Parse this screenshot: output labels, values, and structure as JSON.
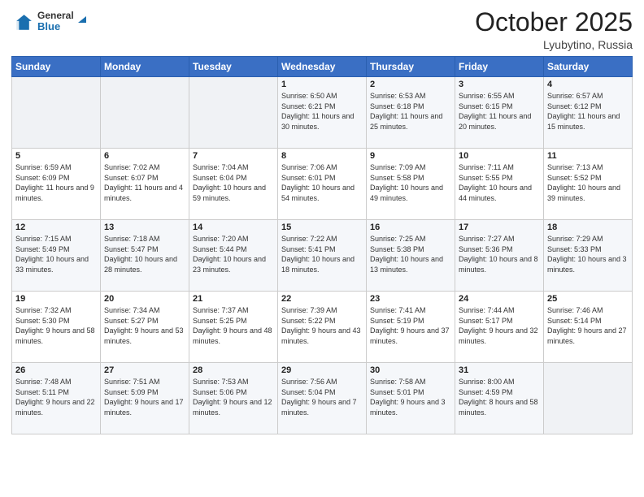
{
  "header": {
    "logo_line1": "General",
    "logo_line2": "Blue",
    "month": "October 2025",
    "location": "Lyubytino, Russia"
  },
  "weekdays": [
    "Sunday",
    "Monday",
    "Tuesday",
    "Wednesday",
    "Thursday",
    "Friday",
    "Saturday"
  ],
  "weeks": [
    [
      {
        "day": "",
        "sunrise": "",
        "sunset": "",
        "daylight": "",
        "empty": true
      },
      {
        "day": "",
        "sunrise": "",
        "sunset": "",
        "daylight": "",
        "empty": true
      },
      {
        "day": "",
        "sunrise": "",
        "sunset": "",
        "daylight": "",
        "empty": true
      },
      {
        "day": "1",
        "sunrise": "Sunrise: 6:50 AM",
        "sunset": "Sunset: 6:21 PM",
        "daylight": "Daylight: 11 hours and 30 minutes.",
        "empty": false
      },
      {
        "day": "2",
        "sunrise": "Sunrise: 6:53 AM",
        "sunset": "Sunset: 6:18 PM",
        "daylight": "Daylight: 11 hours and 25 minutes.",
        "empty": false
      },
      {
        "day": "3",
        "sunrise": "Sunrise: 6:55 AM",
        "sunset": "Sunset: 6:15 PM",
        "daylight": "Daylight: 11 hours and 20 minutes.",
        "empty": false
      },
      {
        "day": "4",
        "sunrise": "Sunrise: 6:57 AM",
        "sunset": "Sunset: 6:12 PM",
        "daylight": "Daylight: 11 hours and 15 minutes.",
        "empty": false
      }
    ],
    [
      {
        "day": "5",
        "sunrise": "Sunrise: 6:59 AM",
        "sunset": "Sunset: 6:09 PM",
        "daylight": "Daylight: 11 hours and 9 minutes.",
        "empty": false
      },
      {
        "day": "6",
        "sunrise": "Sunrise: 7:02 AM",
        "sunset": "Sunset: 6:07 PM",
        "daylight": "Daylight: 11 hours and 4 minutes.",
        "empty": false
      },
      {
        "day": "7",
        "sunrise": "Sunrise: 7:04 AM",
        "sunset": "Sunset: 6:04 PM",
        "daylight": "Daylight: 10 hours and 59 minutes.",
        "empty": false
      },
      {
        "day": "8",
        "sunrise": "Sunrise: 7:06 AM",
        "sunset": "Sunset: 6:01 PM",
        "daylight": "Daylight: 10 hours and 54 minutes.",
        "empty": false
      },
      {
        "day": "9",
        "sunrise": "Sunrise: 7:09 AM",
        "sunset": "Sunset: 5:58 PM",
        "daylight": "Daylight: 10 hours and 49 minutes.",
        "empty": false
      },
      {
        "day": "10",
        "sunrise": "Sunrise: 7:11 AM",
        "sunset": "Sunset: 5:55 PM",
        "daylight": "Daylight: 10 hours and 44 minutes.",
        "empty": false
      },
      {
        "day": "11",
        "sunrise": "Sunrise: 7:13 AM",
        "sunset": "Sunset: 5:52 PM",
        "daylight": "Daylight: 10 hours and 39 minutes.",
        "empty": false
      }
    ],
    [
      {
        "day": "12",
        "sunrise": "Sunrise: 7:15 AM",
        "sunset": "Sunset: 5:49 PM",
        "daylight": "Daylight: 10 hours and 33 minutes.",
        "empty": false
      },
      {
        "day": "13",
        "sunrise": "Sunrise: 7:18 AM",
        "sunset": "Sunset: 5:47 PM",
        "daylight": "Daylight: 10 hours and 28 minutes.",
        "empty": false
      },
      {
        "day": "14",
        "sunrise": "Sunrise: 7:20 AM",
        "sunset": "Sunset: 5:44 PM",
        "daylight": "Daylight: 10 hours and 23 minutes.",
        "empty": false
      },
      {
        "day": "15",
        "sunrise": "Sunrise: 7:22 AM",
        "sunset": "Sunset: 5:41 PM",
        "daylight": "Daylight: 10 hours and 18 minutes.",
        "empty": false
      },
      {
        "day": "16",
        "sunrise": "Sunrise: 7:25 AM",
        "sunset": "Sunset: 5:38 PM",
        "daylight": "Daylight: 10 hours and 13 minutes.",
        "empty": false
      },
      {
        "day": "17",
        "sunrise": "Sunrise: 7:27 AM",
        "sunset": "Sunset: 5:36 PM",
        "daylight": "Daylight: 10 hours and 8 minutes.",
        "empty": false
      },
      {
        "day": "18",
        "sunrise": "Sunrise: 7:29 AM",
        "sunset": "Sunset: 5:33 PM",
        "daylight": "Daylight: 10 hours and 3 minutes.",
        "empty": false
      }
    ],
    [
      {
        "day": "19",
        "sunrise": "Sunrise: 7:32 AM",
        "sunset": "Sunset: 5:30 PM",
        "daylight": "Daylight: 9 hours and 58 minutes.",
        "empty": false
      },
      {
        "day": "20",
        "sunrise": "Sunrise: 7:34 AM",
        "sunset": "Sunset: 5:27 PM",
        "daylight": "Daylight: 9 hours and 53 minutes.",
        "empty": false
      },
      {
        "day": "21",
        "sunrise": "Sunrise: 7:37 AM",
        "sunset": "Sunset: 5:25 PM",
        "daylight": "Daylight: 9 hours and 48 minutes.",
        "empty": false
      },
      {
        "day": "22",
        "sunrise": "Sunrise: 7:39 AM",
        "sunset": "Sunset: 5:22 PM",
        "daylight": "Daylight: 9 hours and 43 minutes.",
        "empty": false
      },
      {
        "day": "23",
        "sunrise": "Sunrise: 7:41 AM",
        "sunset": "Sunset: 5:19 PM",
        "daylight": "Daylight: 9 hours and 37 minutes.",
        "empty": false
      },
      {
        "day": "24",
        "sunrise": "Sunrise: 7:44 AM",
        "sunset": "Sunset: 5:17 PM",
        "daylight": "Daylight: 9 hours and 32 minutes.",
        "empty": false
      },
      {
        "day": "25",
        "sunrise": "Sunrise: 7:46 AM",
        "sunset": "Sunset: 5:14 PM",
        "daylight": "Daylight: 9 hours and 27 minutes.",
        "empty": false
      }
    ],
    [
      {
        "day": "26",
        "sunrise": "Sunrise: 7:48 AM",
        "sunset": "Sunset: 5:11 PM",
        "daylight": "Daylight: 9 hours and 22 minutes.",
        "empty": false
      },
      {
        "day": "27",
        "sunrise": "Sunrise: 7:51 AM",
        "sunset": "Sunset: 5:09 PM",
        "daylight": "Daylight: 9 hours and 17 minutes.",
        "empty": false
      },
      {
        "day": "28",
        "sunrise": "Sunrise: 7:53 AM",
        "sunset": "Sunset: 5:06 PM",
        "daylight": "Daylight: 9 hours and 12 minutes.",
        "empty": false
      },
      {
        "day": "29",
        "sunrise": "Sunrise: 7:56 AM",
        "sunset": "Sunset: 5:04 PM",
        "daylight": "Daylight: 9 hours and 7 minutes.",
        "empty": false
      },
      {
        "day": "30",
        "sunrise": "Sunrise: 7:58 AM",
        "sunset": "Sunset: 5:01 PM",
        "daylight": "Daylight: 9 hours and 3 minutes.",
        "empty": false
      },
      {
        "day": "31",
        "sunrise": "Sunrise: 8:00 AM",
        "sunset": "Sunset: 4:59 PM",
        "daylight": "Daylight: 8 hours and 58 minutes.",
        "empty": false
      },
      {
        "day": "",
        "sunrise": "",
        "sunset": "",
        "daylight": "",
        "empty": true
      }
    ]
  ]
}
